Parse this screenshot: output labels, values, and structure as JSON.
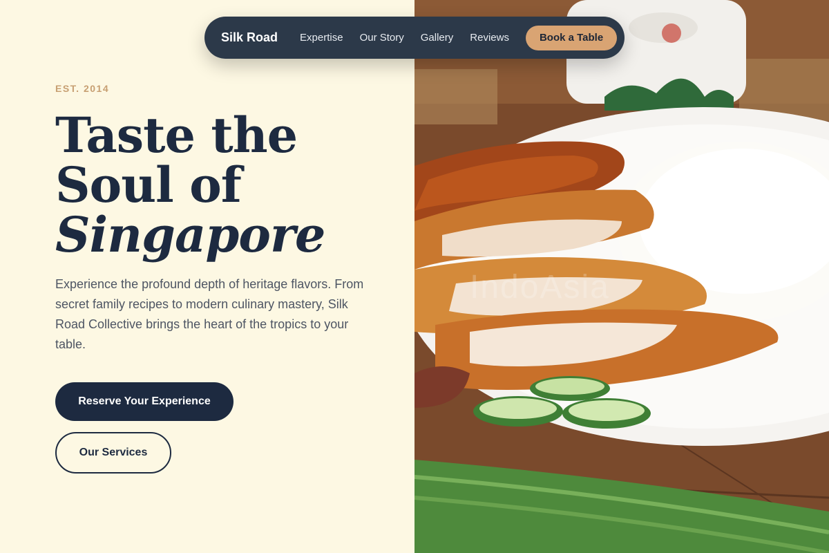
{
  "nav": {
    "brand": "Silk Road",
    "links": [
      "Expertise",
      "Our Story",
      "Gallery",
      "Reviews"
    ],
    "cta": "Book a Table"
  },
  "hero": {
    "eyebrow": "EST. 2014",
    "headline_line1": "Taste the",
    "headline_line2": "Soul of",
    "headline_line3": "Singapore",
    "description": "Experience the profound depth of heritage flavors. From secret family recipes to modern culinary mastery, Silk Road Collective brings the heart of the tropics to your table.",
    "primary_button": "Reserve Your Experience",
    "secondary_button": "Our Services"
  },
  "photo": {
    "watermark": "IndoAsia"
  },
  "colors": {
    "cream_background": "#fdf8e3",
    "navy": "#1d2a40",
    "nav_background": "#2c3949",
    "accent_tan": "#d9a473",
    "eyebrow_tan": "#c79f72"
  }
}
